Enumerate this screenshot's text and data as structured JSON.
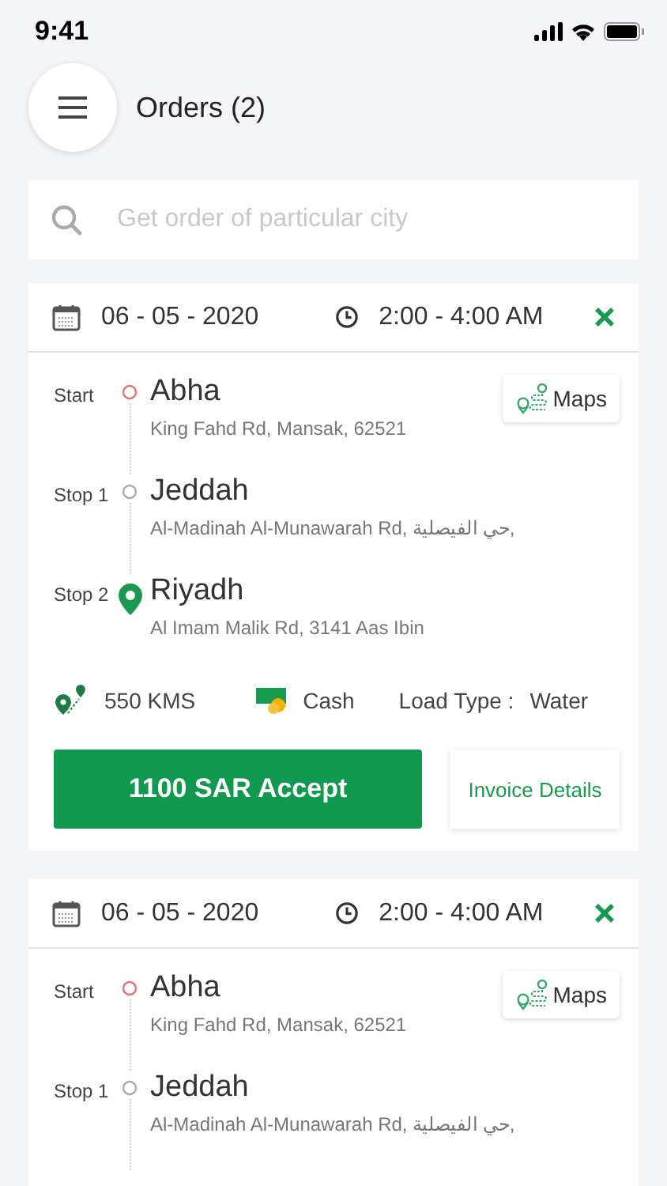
{
  "status_bar": {
    "time": "9:41"
  },
  "header": {
    "title": "Orders (2)"
  },
  "search": {
    "placeholder": "Get order of particular city"
  },
  "orders": [
    {
      "date": "06 - 05 - 2020",
      "time": "2:00 - 4:00 AM",
      "maps_label": "Maps",
      "stops": [
        {
          "label": "Start",
          "kind": "start",
          "city": "Abha",
          "address": "King Fahd Rd, Mansak, 62521"
        },
        {
          "label": "Stop 1",
          "kind": "stop",
          "city": "Jeddah",
          "address": "Al-Madinah Al-Munawarah Rd, حي الفيصلية,"
        },
        {
          "label": "Stop 2",
          "kind": "end",
          "city": "Riyadh",
          "address": "Al Imam Malik Rd, 3141 Aas Ibin"
        }
      ],
      "distance": "550 KMS",
      "payment": "Cash",
      "load_type_label": "Load Type :",
      "load_type": "Water",
      "accept_label": "1100 SAR Accept",
      "invoice_label": "Invoice Details"
    },
    {
      "date": "06 - 05 - 2020",
      "time": "2:00 - 4:00 AM",
      "maps_label": "Maps",
      "stops": [
        {
          "label": "Start",
          "kind": "start",
          "city": "Abha",
          "address": "King Fahd Rd, Mansak, 62521"
        },
        {
          "label": "Stop 1",
          "kind": "stop",
          "city": "Jeddah",
          "address": "Al-Madinah Al-Munawarah Rd, حي الفيصلية,"
        }
      ]
    }
  ]
}
